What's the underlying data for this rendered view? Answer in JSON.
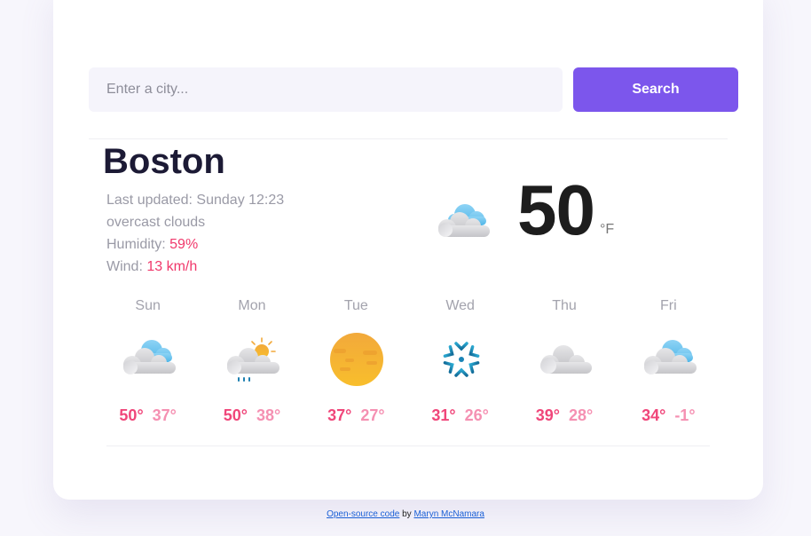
{
  "search": {
    "placeholder": "Enter a city...",
    "button_label": "Search"
  },
  "current": {
    "city": "Boston",
    "updated_label": "Last updated:",
    "updated_value": "Sunday 12:23",
    "description": "overcast clouds",
    "humidity_label": "Humidity:",
    "humidity_value": "59%",
    "wind_label": "Wind:",
    "wind_value": "13 km/h",
    "temperature": "50",
    "unit": "°F",
    "icon": "overcast-clouds-icon"
  },
  "forecast": [
    {
      "day": "Sun",
      "high": "50°",
      "low": "37°",
      "icon": "cloud-sky-icon"
    },
    {
      "day": "Mon",
      "high": "50°",
      "low": "38°",
      "icon": "sun-rain-cloud-icon"
    },
    {
      "day": "Tue",
      "high": "37°",
      "low": "27°",
      "icon": "sun-haze-icon"
    },
    {
      "day": "Wed",
      "high": "31°",
      "low": "26°",
      "icon": "snowflake-icon"
    },
    {
      "day": "Thu",
      "high": "39°",
      "low": "28°",
      "icon": "grey-cloud-icon"
    },
    {
      "day": "Fri",
      "high": "34°",
      "low": "-1°",
      "icon": "cloud-sky-icon"
    }
  ],
  "footer": {
    "link1": "Open-source code",
    "by": "by",
    "link2": "Maryn McNamara"
  },
  "colors": {
    "accent": "#7c56ec",
    "highlight": "#f0386b",
    "high_temp": "#f0467a",
    "low_temp": "#f590b2"
  }
}
